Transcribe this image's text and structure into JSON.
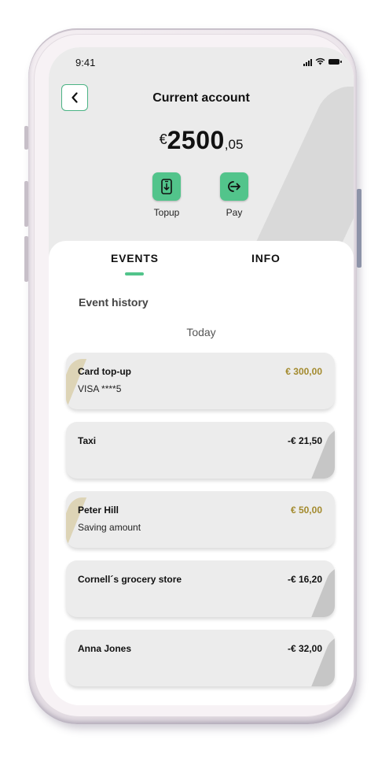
{
  "status_bar": {
    "time": "9:41"
  },
  "header": {
    "title": "Current account",
    "balance_currency": "€",
    "balance_integer": "2500",
    "balance_decimal": ",05"
  },
  "actions": [
    {
      "label": "Topup",
      "icon": "mobile-topup-icon"
    },
    {
      "label": "Pay",
      "icon": "pay-icon"
    }
  ],
  "tabs": [
    {
      "label": "EVENTS",
      "active": true
    },
    {
      "label": "INFO",
      "active": false
    }
  ],
  "events": {
    "section_title": "Event history",
    "day_label": "Today",
    "items": [
      {
        "name": "Card top-up",
        "subtitle": "VISA ****5",
        "amount": "€ 300,00",
        "type": "credit"
      },
      {
        "name": "Taxi",
        "subtitle": "",
        "amount": "-€ 21,50",
        "type": "debit"
      },
      {
        "name": "Peter Hill",
        "subtitle": "Saving amount",
        "amount": "€ 50,00",
        "type": "credit"
      },
      {
        "name": "Cornell´s grocery store",
        "subtitle": "",
        "amount": "-€ 16,20",
        "type": "debit"
      },
      {
        "name": "Anna Jones",
        "subtitle": "",
        "amount": "-€ 32,00",
        "type": "debit"
      }
    ]
  },
  "colors": {
    "accent": "#52c48b",
    "credit_amount": "#a38a2d",
    "header_background": "#ebebeb",
    "card_background": "#ececec"
  }
}
